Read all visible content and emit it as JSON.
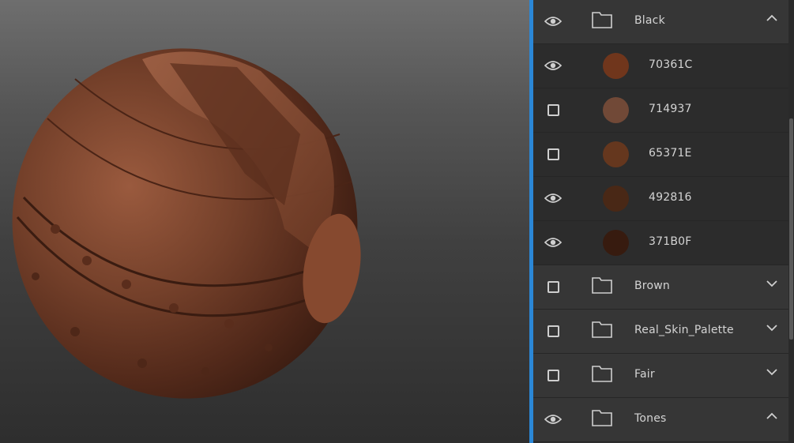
{
  "layers": {
    "black_group": {
      "name": "Black",
      "visible": true,
      "expanded": true
    },
    "swatches": [
      {
        "hex": "70361C",
        "color": "#70361C",
        "visible": true
      },
      {
        "hex": "714937",
        "color": "#714937",
        "visible": false
      },
      {
        "hex": "65371E",
        "color": "#65371E",
        "visible": false
      },
      {
        "hex": "492816",
        "color": "#492816",
        "visible": true
      },
      {
        "hex": "371B0F",
        "color": "#371B0F",
        "visible": true
      }
    ],
    "folders": [
      {
        "name": "Brown",
        "visible": false,
        "expanded": false
      },
      {
        "name": "Real_Skin_Palette",
        "visible": false,
        "expanded": false
      },
      {
        "name": "Fair",
        "visible": false,
        "expanded": false
      },
      {
        "name": "Tones",
        "visible": true,
        "expanded": true
      }
    ]
  },
  "colors": {
    "accent": "#2b87d6",
    "sphere_base": "#6a3a25"
  }
}
